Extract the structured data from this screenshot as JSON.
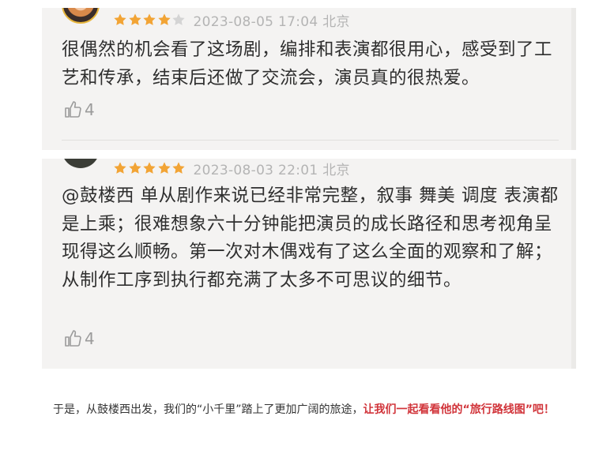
{
  "reviews": [
    {
      "rating": 4,
      "max_rating": 5,
      "date": "2023-08-05 17:04 北京",
      "text": "很偶然的机会看了这场剧，编排和表演都很用心，感受到了工艺和传承，结束后还做了交流会，演员真的很热爱。",
      "likes": "4"
    },
    {
      "rating": 5,
      "max_rating": 5,
      "date": "2023-08-03 22:01 北京",
      "text": "@鼓楼西 单从剧作来说已经非常完整，叙事 舞美 调度 表演都是上乘；很难想象六十分钟能把演员的成长路径和思考视角呈现得这么顺畅。第一次对木偶戏有了这么全面的观察和了解；从制作工序到执行都充满了太多不可思议的细节。",
      "likes": "4"
    }
  ],
  "caption": {
    "plain": "于是，从鼓楼西出发，我们的“小千里”踏上了更加广阔的旅途，",
    "highlight": "让我们一起看看他的“旅行路线图”吧！",
    "highlight_color": "#d1343a"
  },
  "colors": {
    "star_filled": "#f2a435",
    "star_empty": "#d4d4d4",
    "card_bg": "#f4f3f2"
  },
  "icons": {
    "rating": "star-icon",
    "like": "thumbs-up-icon"
  }
}
